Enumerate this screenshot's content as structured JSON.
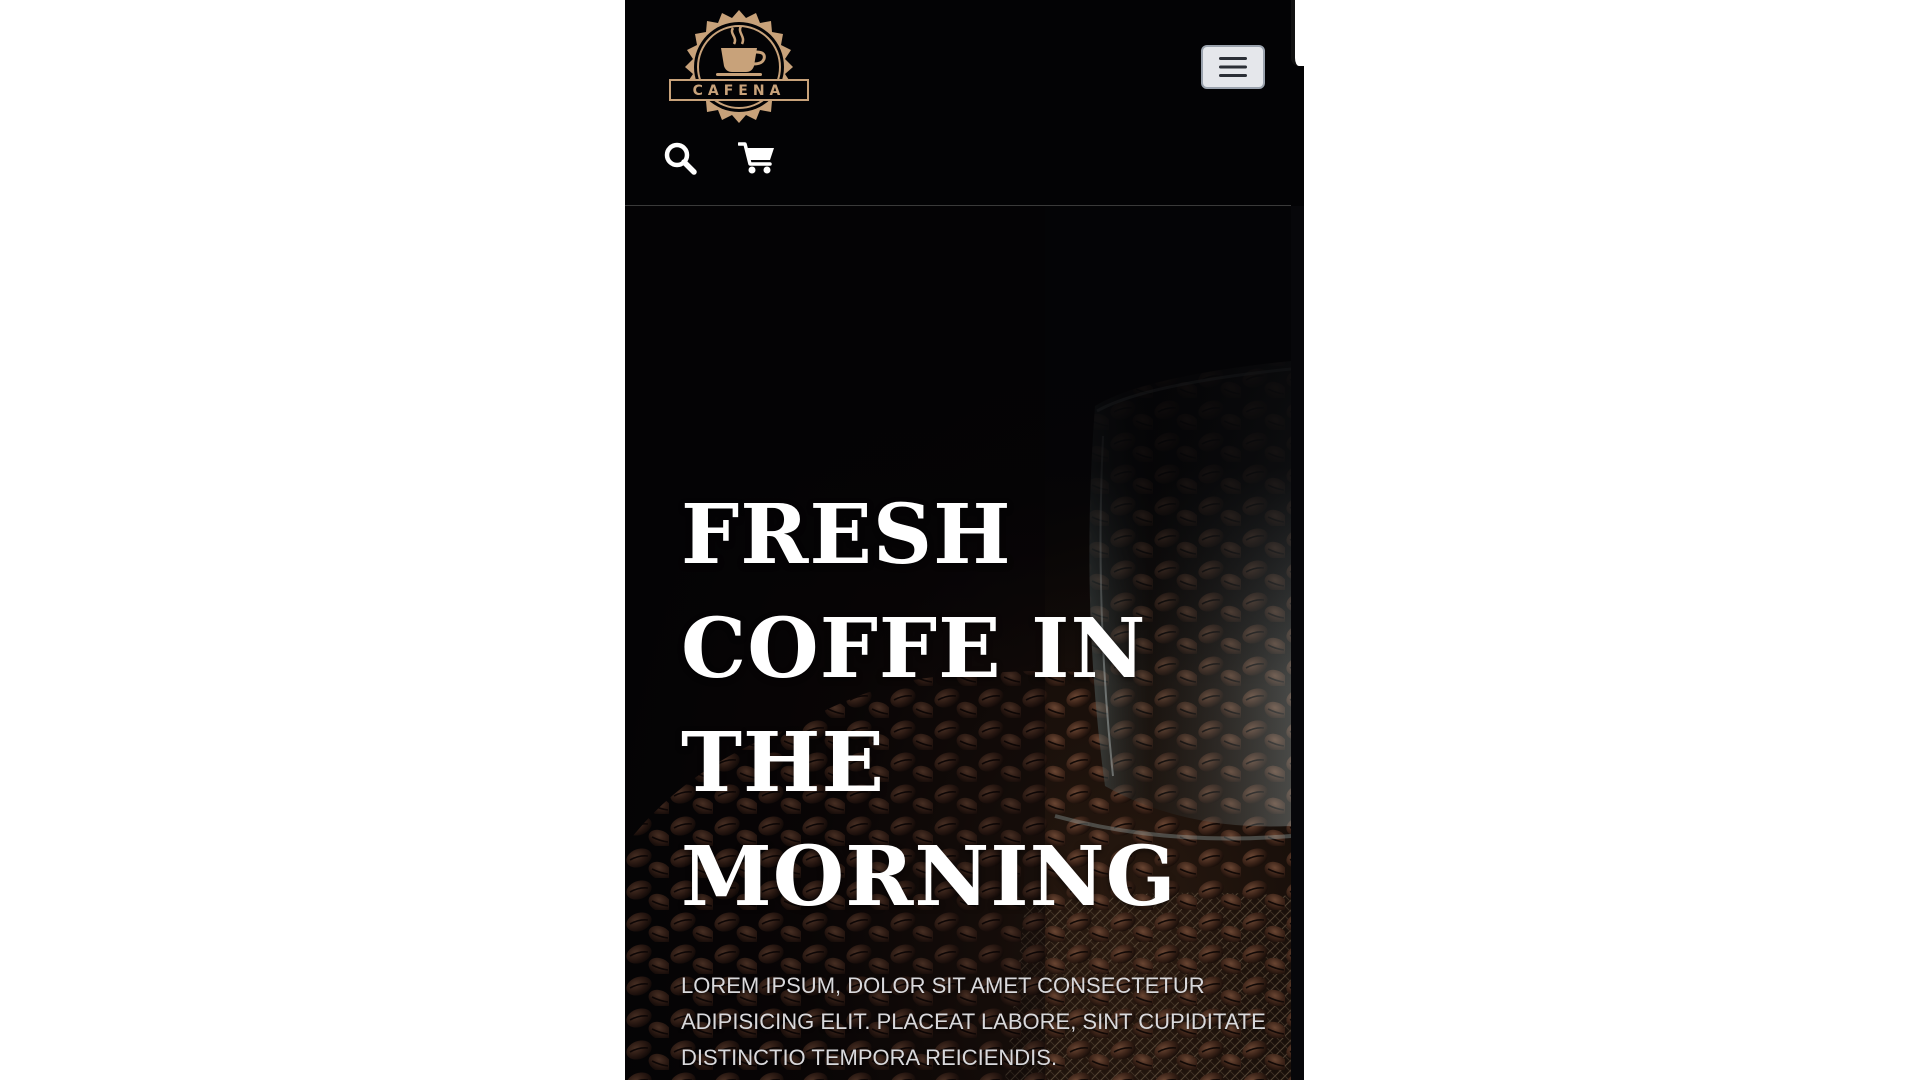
{
  "brand": {
    "name": "CAFENA",
    "accent_color": "#c8a27a",
    "logo_icon": "coffee-cup-badge"
  },
  "navbar": {
    "toggler_icon": "hamburger-menu-icon",
    "search_icon": "search-icon",
    "cart_icon": "shopping-cart-icon"
  },
  "hero": {
    "title": "FRESH COFFE IN THE MORNING",
    "text": "LOREM IPSUM, DOLOR SIT AMET CONSECTETUR ADIPISICING ELIT. PLACEAT LABORE, SINT CUPIDITATE DISTINCTIO TEMPORA REICIENDIS.",
    "background": "coffee-beans-glass-jar-photo"
  }
}
